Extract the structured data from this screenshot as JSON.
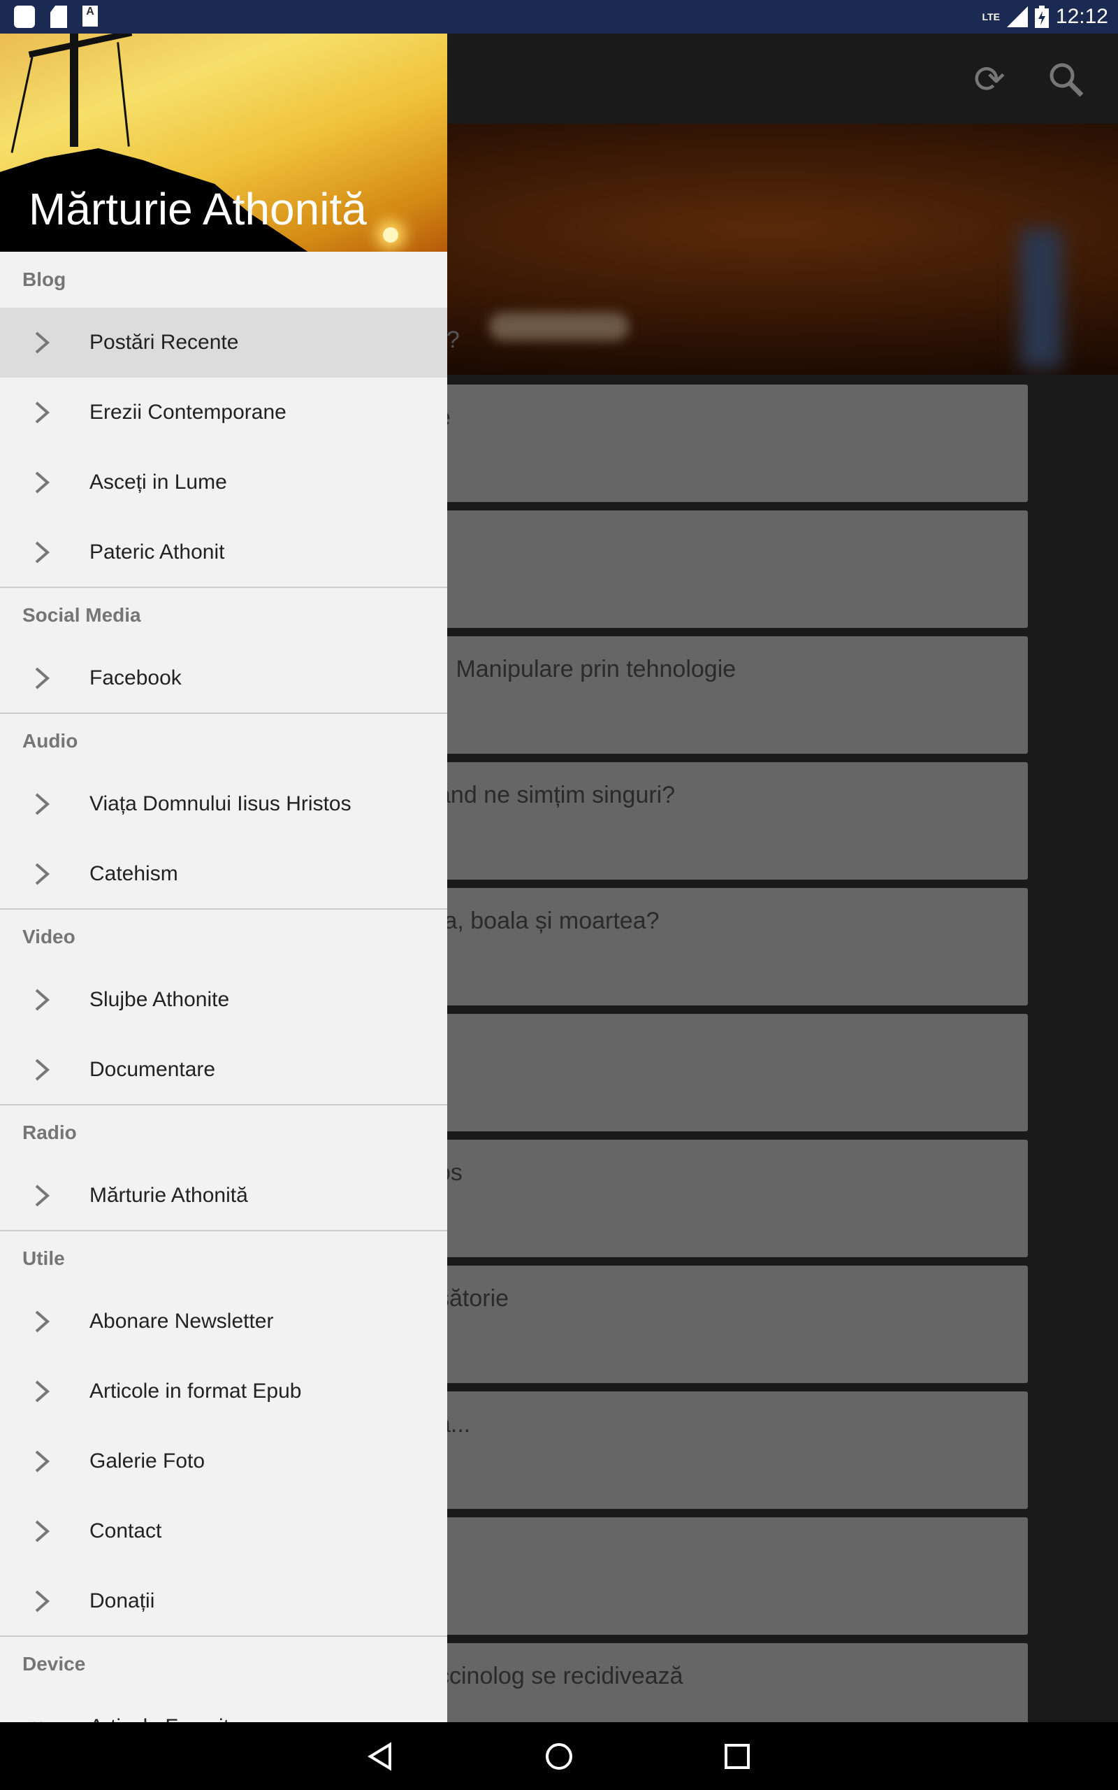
{
  "status_bar": {
    "time": "12:12",
    "network": "LTE",
    "icons": [
      "app-notification-icon",
      "sd-card-icon",
      "keyboard-a-icon",
      "signal-icon",
      "battery-charging-icon"
    ]
  },
  "toolbar": {
    "refresh_icon": "refresh-icon",
    "search_icon": "search-icon"
  },
  "hero": {
    "title_fragment": "e?"
  },
  "cards": [
    "e",
    "",
    "i. Manipulare prin tehnologie",
    "ând ne simțim singuri?",
    "ța, boala și moartea?",
    "",
    "os",
    "sătorie",
    "a...",
    "",
    "ccinolog se recidivează"
  ],
  "drawer": {
    "title": "Mărturie Athonită",
    "sections": [
      {
        "header": "Blog",
        "items": [
          "Postări Recente",
          "Erezii Contemporane",
          "Asceți in Lume",
          "Pateric Athonit"
        ]
      },
      {
        "header": "Social Media",
        "items": [
          "Facebook"
        ]
      },
      {
        "header": "Audio",
        "items": [
          "Viața Domnului Iisus Hristos",
          "Catehism"
        ]
      },
      {
        "header": "Video",
        "items": [
          "Slujbe Athonite",
          "Documentare"
        ]
      },
      {
        "header": "Radio",
        "items": [
          "Mărturie Athonită"
        ]
      },
      {
        "header": "Utile",
        "items": [
          "Abonare Newsletter",
          "Articole in format Epub",
          "Galerie Foto",
          "Contact",
          "Donații"
        ]
      },
      {
        "header": "Device",
        "items": [
          "Articole Favorite"
        ]
      }
    ],
    "active_item": "Postări Recente"
  },
  "nav_bar": {
    "back": "back-icon",
    "home": "home-icon",
    "recents": "recents-icon"
  }
}
